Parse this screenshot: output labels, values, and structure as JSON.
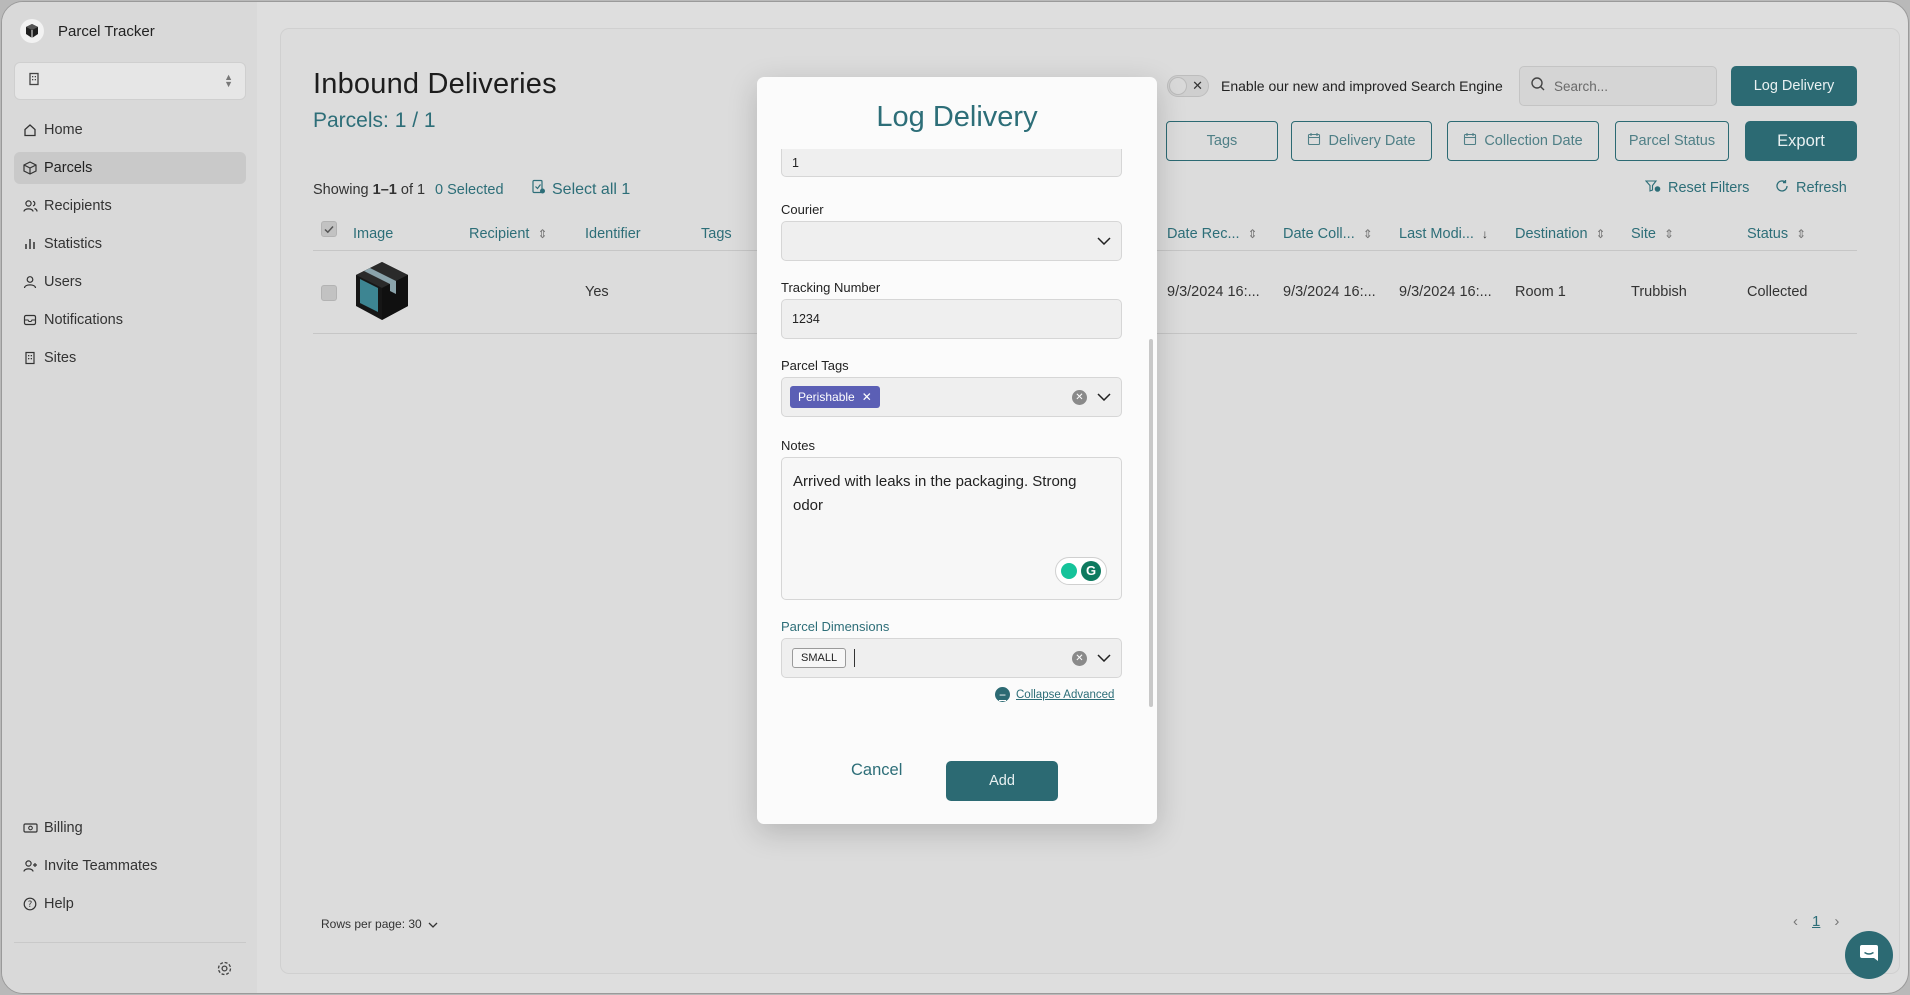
{
  "app": {
    "title": "Parcel Tracker"
  },
  "sidebar": {
    "items": [
      {
        "label": "Home",
        "icon": "home-icon"
      },
      {
        "label": "Parcels",
        "icon": "parcel-icon"
      },
      {
        "label": "Recipients",
        "icon": "users-icon"
      },
      {
        "label": "Statistics",
        "icon": "bar-chart-icon"
      },
      {
        "label": "Users",
        "icon": "user-icon"
      },
      {
        "label": "Notifications",
        "icon": "notification-icon"
      },
      {
        "label": "Sites",
        "icon": "building-icon"
      }
    ],
    "bottom_items": [
      {
        "label": "Billing",
        "icon": "billing-icon"
      },
      {
        "label": "Invite Teammates",
        "icon": "invite-icon"
      },
      {
        "label": "Help",
        "icon": "help-icon"
      }
    ]
  },
  "header": {
    "title": "Inbound Deliveries",
    "subtitle": "Parcels: 1 / 1",
    "search_engine_toggle_label": "Enable our new and improved Search Engine",
    "search_placeholder": "Search...",
    "log_delivery_label": "Log Delivery",
    "export_label": "Export"
  },
  "filters": {
    "tags": "Tags",
    "delivery_date": "Delivery Date",
    "collection_date": "Collection Date",
    "parcel_status": "Parcel Status"
  },
  "toolbar": {
    "showing_prefix": "Showing",
    "showing_range": "1–1",
    "showing_suffix": "of 1",
    "selected": "0 Selected",
    "select_all": "Select all 1",
    "reset_filters": "Reset Filters",
    "refresh": "Refresh"
  },
  "table": {
    "columns": {
      "image": "Image",
      "recipient": "Recipient",
      "identifier": "Identifier",
      "tags": "Tags",
      "date_received": "Date Rec...",
      "date_collected": "Date Coll...",
      "last_modified": "Last Modi...",
      "destination": "Destination",
      "site": "Site",
      "status": "Status"
    },
    "rows": [
      {
        "identifier": "Yes",
        "date_received": "9/3/2024 16:...",
        "date_collected": "9/3/2024 16:...",
        "last_modified": "9/3/2024 16:...",
        "destination": "Room 1",
        "site": "Trubbish",
        "status": "Collected"
      }
    ]
  },
  "footer": {
    "rows_per_page": "Rows per page: 30",
    "current_page": "1"
  },
  "modal": {
    "title": "Log Delivery",
    "quantity_value": "1",
    "courier_label": "Courier",
    "courier_value": "",
    "tracking_label": "Tracking Number",
    "tracking_value": "1234",
    "tags_label": "Parcel Tags",
    "tag_chip": "Perishable",
    "notes_label": "Notes",
    "notes_value": "Arrived with leaks in the packaging. Strong odor",
    "dimensions_label": "Parcel Dimensions",
    "dimension_chip": "SMALL",
    "collapse_advanced": "Collapse Advanced",
    "cancel_label": "Cancel",
    "add_label": "Add"
  },
  "colors": {
    "accent": "#2c6a73",
    "tag_chip": "#5b5fb5",
    "overlay": "#dcdcdc"
  }
}
